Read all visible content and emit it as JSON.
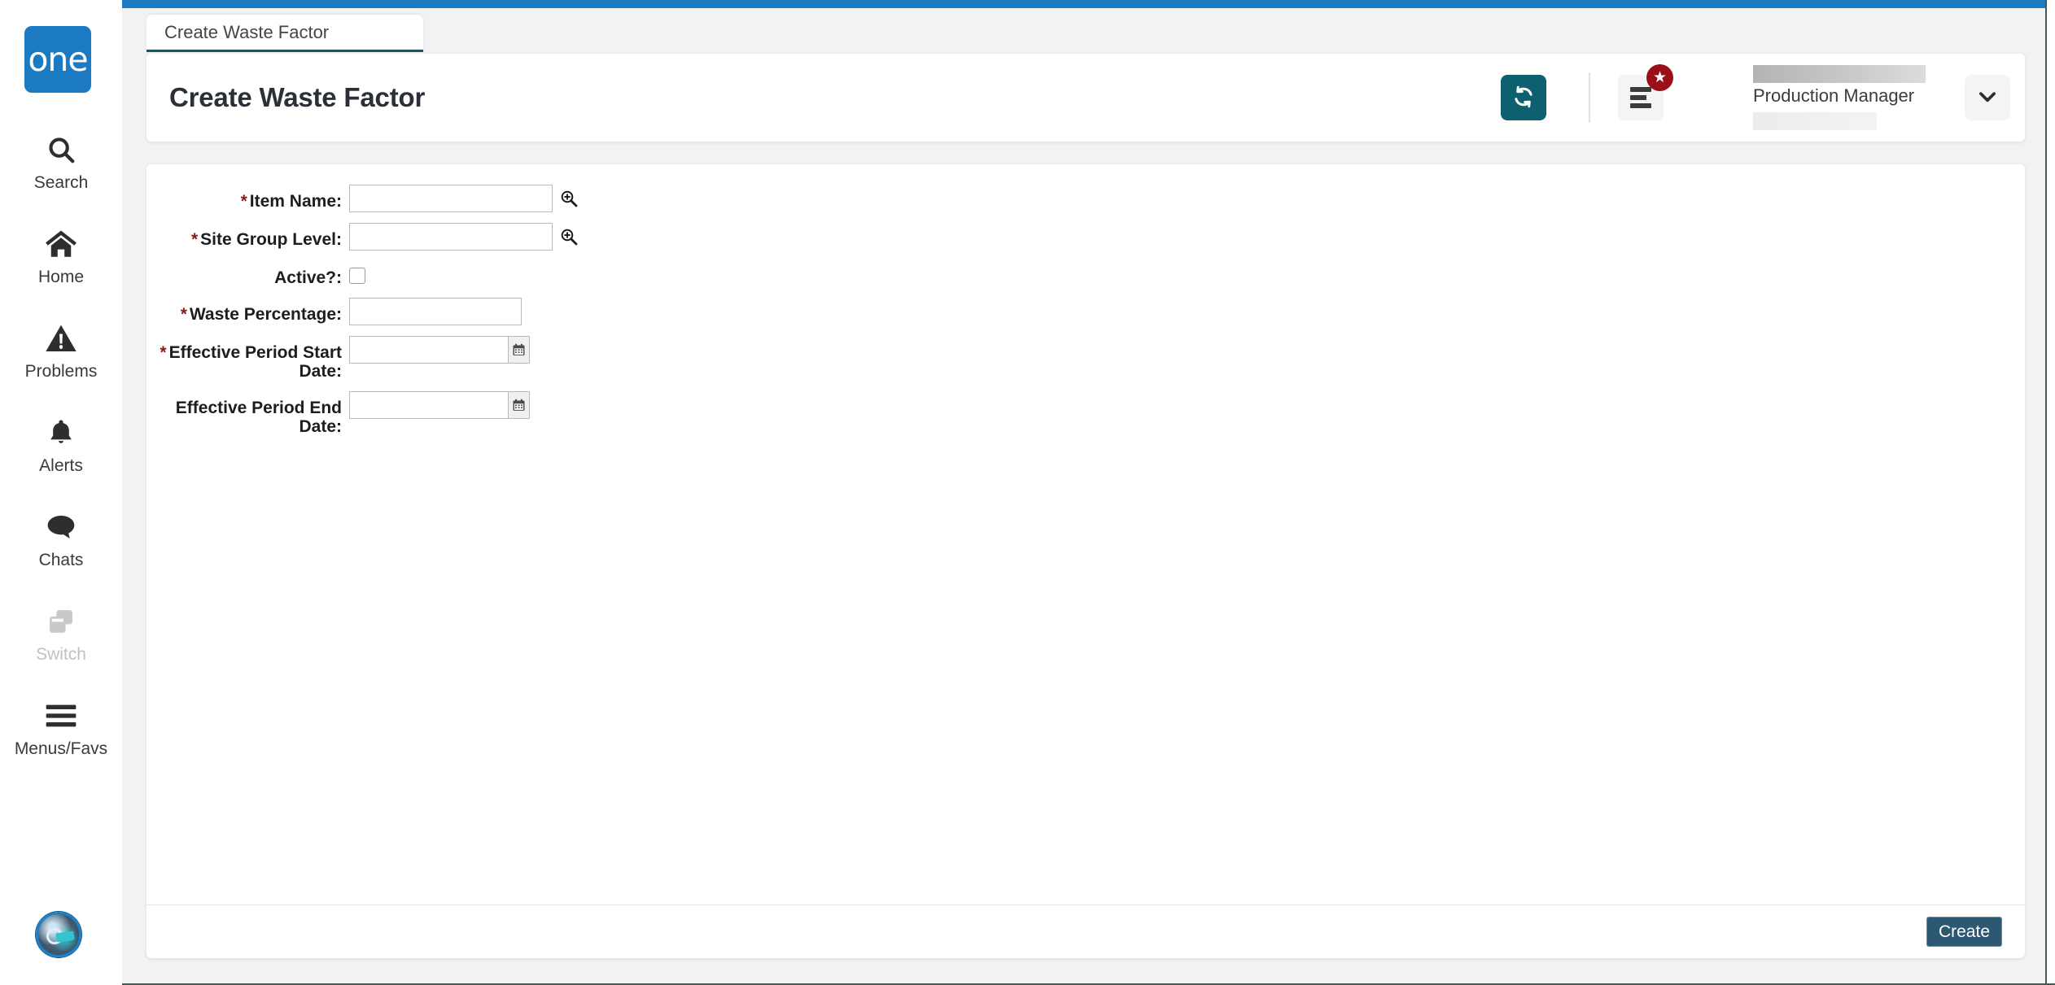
{
  "app": {
    "brand": "one",
    "brand_icon": "one-logo",
    "accent_blue": "#1b7ac2",
    "accent_teal": "#0d6070",
    "tab_active_underline": "#0d5b66",
    "required_marker_color": "#8b1a1a",
    "badge_color": "#9b1018",
    "create_button_color": "#2c5871"
  },
  "sidebar": {
    "items": [
      {
        "label": "Search",
        "icon": "search-icon",
        "enabled": true
      },
      {
        "label": "Home",
        "icon": "home-icon",
        "enabled": true
      },
      {
        "label": "Problems",
        "icon": "warning-icon",
        "enabled": true
      },
      {
        "label": "Alerts",
        "icon": "bell-icon",
        "enabled": true
      },
      {
        "label": "Chats",
        "icon": "chat-icon",
        "enabled": true
      },
      {
        "label": "Switch",
        "icon": "switch-icon",
        "enabled": false
      },
      {
        "label": "Menus/Favs",
        "icon": "hamburger-icon",
        "enabled": true
      }
    ],
    "avatar": {
      "icon": "robot-avatar-icon"
    }
  },
  "tabs": [
    {
      "label": "Create Waste Factor",
      "active": true
    }
  ],
  "header": {
    "title": "Create Waste Factor",
    "refresh_icon": "refresh-icon",
    "menu_icon": "menu-list-icon",
    "badge_icon": "star-icon",
    "caret_icon": "chevron-down-icon",
    "user": {
      "name_redacted": true,
      "role": "Production Manager",
      "secondary_redacted": true
    }
  },
  "form": {
    "fields": [
      {
        "label": "Item Name:",
        "required": true,
        "type": "text-lookup",
        "value": "",
        "placeholder": "",
        "trailing_icon": "magnifier-plus-icon"
      },
      {
        "label": "Site Group Level:",
        "required": true,
        "type": "text-lookup",
        "value": "",
        "placeholder": "",
        "trailing_icon": "magnifier-plus-icon"
      },
      {
        "label": "Active?:",
        "required": false,
        "type": "checkbox",
        "checked": false
      },
      {
        "label": "Waste Percentage:",
        "required": true,
        "type": "text",
        "value": "",
        "placeholder": ""
      },
      {
        "label": "Effective Period Start\nDate:",
        "required": true,
        "type": "date",
        "value": "",
        "placeholder": "",
        "trailing_icon": "calendar-icon"
      },
      {
        "label": "Effective Period End Date:",
        "required": false,
        "type": "date",
        "value": "",
        "placeholder": "",
        "trailing_icon": "calendar-icon"
      }
    ]
  },
  "footer": {
    "create_label": "Create"
  }
}
